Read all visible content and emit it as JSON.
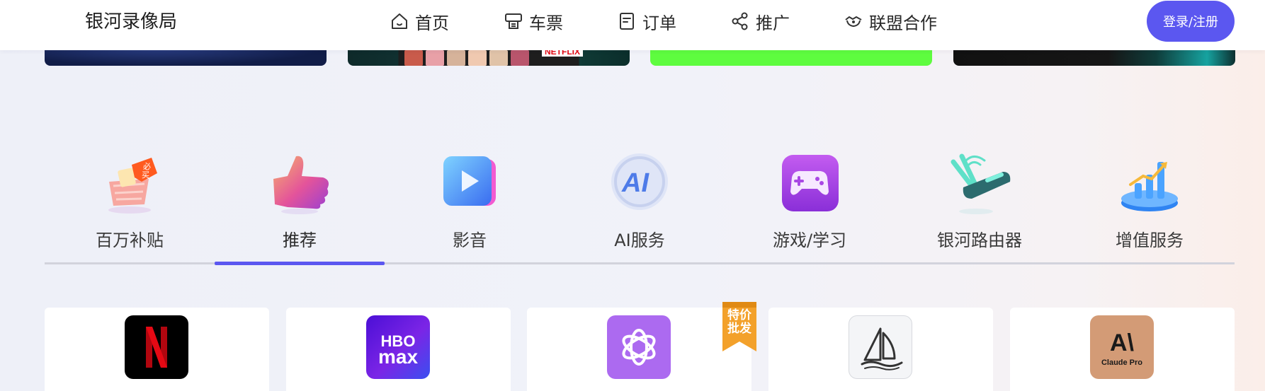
{
  "header": {
    "brand": "银河录像局",
    "nav": [
      {
        "label": "首页",
        "icon": "home-icon"
      },
      {
        "label": "车票",
        "icon": "ticket-icon"
      },
      {
        "label": "订单",
        "icon": "order-icon"
      },
      {
        "label": "推广",
        "icon": "share-icon"
      },
      {
        "label": "联盟合作",
        "icon": "handshake-icon"
      }
    ],
    "login_label": "登录/注册"
  },
  "banner": {
    "netflix_text": "NETFLIX"
  },
  "categories": {
    "active_index": 1,
    "items": [
      {
        "label": "百万补贴",
        "icon": "subsidy-basket-icon"
      },
      {
        "label": "推荐",
        "icon": "thumbs-up-icon"
      },
      {
        "label": "影音",
        "icon": "play-icon"
      },
      {
        "label": "AI服务",
        "icon": "ai-icon"
      },
      {
        "label": "游戏/学习",
        "icon": "gamepad-icon"
      },
      {
        "label": "银河路由器",
        "icon": "router-icon"
      },
      {
        "label": "增值服务",
        "icon": "growth-chart-icon"
      }
    ]
  },
  "products": {
    "items": [
      {
        "name": "Netflix",
        "icon": "netflix-logo-icon"
      },
      {
        "name": "HBO Max",
        "icon": "hbo-max-logo-icon",
        "logo_text_top": "HBO",
        "logo_text_bottom": "max"
      },
      {
        "name": "ChatGPT",
        "icon": "openai-logo-icon"
      },
      {
        "name": "Midjourney",
        "icon": "midjourney-logo-icon"
      },
      {
        "name": "Claude Pro",
        "icon": "claude-logo-icon",
        "logo_text_top": "A\\",
        "logo_text_bottom": "Claude Pro"
      }
    ],
    "special_badge": [
      "特价",
      "批发"
    ]
  },
  "colors": {
    "accent": "#5b57f0",
    "netflix_red": "#e50914",
    "badge_orange": "#f3a12b"
  }
}
